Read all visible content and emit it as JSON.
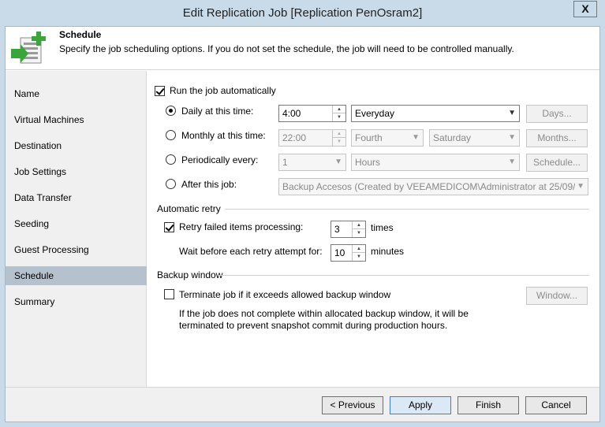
{
  "window": {
    "title": "Edit Replication Job [Replication PenOsram2]",
    "close_glyph": "X"
  },
  "header": {
    "title": "Schedule",
    "description": "Specify the job scheduling options. If you do not set the schedule, the job will need to be controlled manually.",
    "icon": "schedule-wizard-icon"
  },
  "nav": {
    "items": [
      {
        "label": "Name"
      },
      {
        "label": "Virtual Machines"
      },
      {
        "label": "Destination"
      },
      {
        "label": "Job Settings"
      },
      {
        "label": "Data Transfer"
      },
      {
        "label": "Seeding"
      },
      {
        "label": "Guest Processing"
      },
      {
        "label": "Schedule",
        "active": true
      },
      {
        "label": "Summary"
      }
    ]
  },
  "schedule": {
    "run_auto": {
      "label": "Run the job automatically",
      "checked": true
    },
    "daily": {
      "label": "Daily at this time:",
      "selected": true,
      "time": "4:00",
      "days": "Everyday",
      "button": "Days..."
    },
    "monthly": {
      "label": "Monthly at this time:",
      "time": "22:00",
      "week": "Fourth",
      "day": "Saturday",
      "button": "Months..."
    },
    "periodic": {
      "label": "Periodically every:",
      "value": "1",
      "unit": "Hours",
      "button": "Schedule..."
    },
    "after": {
      "label": "After this job:",
      "value": "Backup Accesos (Created by VEEAMEDICOM\\Administrator at 25/09/2"
    }
  },
  "retry": {
    "group_label": "Automatic retry",
    "retry_label": "Retry failed items processing:",
    "retry_checked": true,
    "retry_count": "3",
    "retry_unit": "times",
    "wait_label": "Wait before each retry attempt for:",
    "wait_value": "10",
    "wait_unit": "minutes"
  },
  "backup_window": {
    "group_label": "Backup window",
    "terminate_label": "Terminate job if it exceeds allowed backup window",
    "terminate_checked": false,
    "window_button": "Window...",
    "note_line1": "If the job does not complete within allocated backup window, it will be",
    "note_line2": "terminated to prevent snapshot commit during production hours."
  },
  "footer": {
    "previous": "< Previous",
    "apply": "Apply",
    "finish": "Finish",
    "cancel": "Cancel"
  },
  "colors": {
    "title_bg": "#c9dbe9",
    "nav_active": "#b5c2cd",
    "icon_green": "#3aa53a"
  }
}
